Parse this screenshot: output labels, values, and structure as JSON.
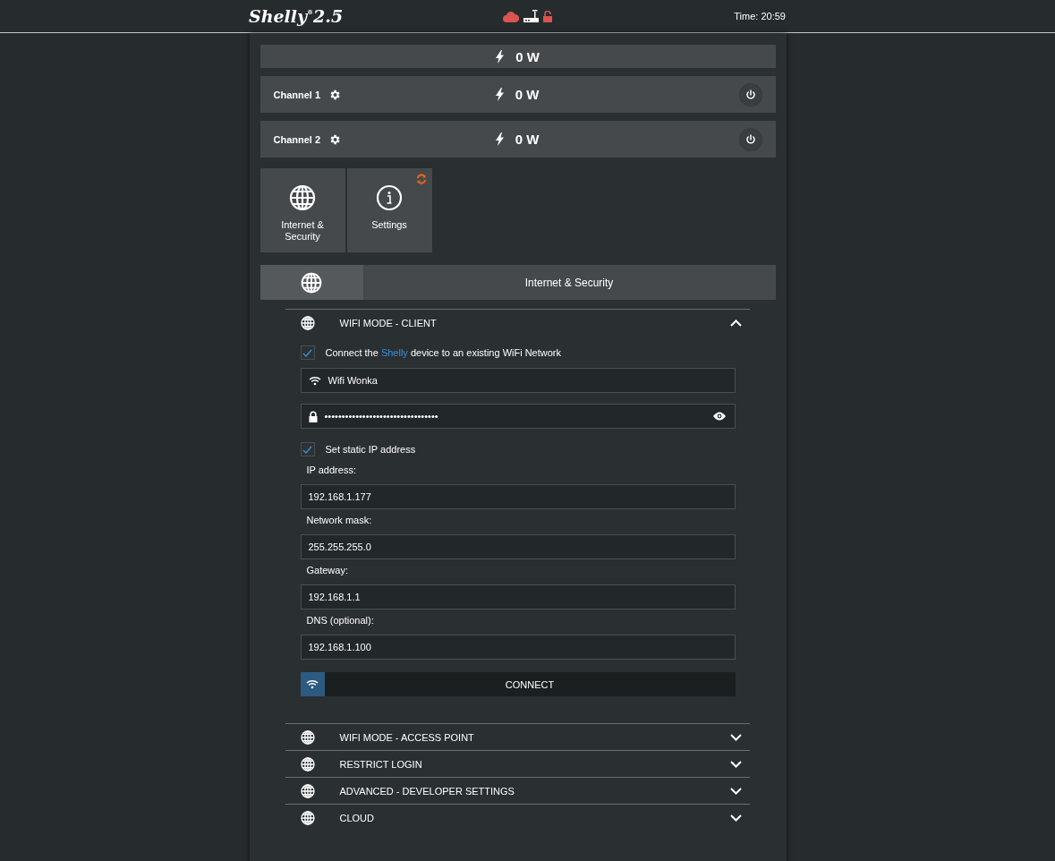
{
  "header": {
    "logo": "Shelly",
    "logo_mark": "®",
    "version": "2.5",
    "time": "Time: 20:59"
  },
  "total": {
    "power": "0 W"
  },
  "channels": [
    {
      "name": "Channel 1",
      "power": "0 W"
    },
    {
      "name": "Channel 2",
      "power": "0 W"
    }
  ],
  "tiles": [
    {
      "label": "Internet & Security",
      "kind": "globe",
      "badge": false
    },
    {
      "label": "Settings",
      "kind": "info",
      "badge": true
    }
  ],
  "section": {
    "title": "Internet & Security"
  },
  "panels": [
    {
      "title": "WIFI MODE - CLIENT",
      "expanded": true
    },
    {
      "title": "WIFI MODE - ACCESS POINT",
      "expanded": false
    },
    {
      "title": "RESTRICT LOGIN",
      "expanded": false
    },
    {
      "title": "ADVANCED - DEVELOPER SETTINGS",
      "expanded": false
    },
    {
      "title": "CLOUD",
      "expanded": false
    }
  ],
  "wifi_client": {
    "enable": {
      "checked": true,
      "text_before": "Connect the",
      "link": "Shelly",
      "text_after": "device to an existing WiFi Network"
    },
    "ssid": "Wifi Wonka",
    "password": "•••••••••••••••••••••••••••••••••",
    "static_ip": {
      "checked": true,
      "label": "Set static IP address"
    },
    "fields": [
      {
        "label": "IP address:",
        "value": "192.168.1.177"
      },
      {
        "label": "Network mask:",
        "value": "255.255.255.0"
      },
      {
        "label": "Gateway:",
        "value": "192.168.1.1"
      },
      {
        "label": "DNS (optional):",
        "value": "192.168.1.100"
      }
    ],
    "button": "CONNECT"
  }
}
